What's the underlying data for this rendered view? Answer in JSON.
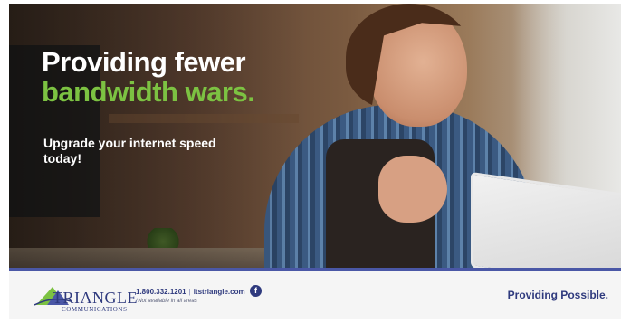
{
  "headline": {
    "line1": "Providing fewer",
    "line2": "bandwidth wars."
  },
  "subhead": "Upgrade your internet speed today!",
  "footer": {
    "logo_text": "TRIANGLE",
    "logo_subtext": "COMMUNICATIONS",
    "phone": "1.800.332.1201",
    "separator": "|",
    "website": "itstriangle.com",
    "disclaimer": "*Not available in all areas",
    "facebook_glyph": "f",
    "tagline": "Providing Possible."
  },
  "colors": {
    "accent_green": "#7cc242",
    "brand_blue": "#2f3a7e",
    "rule_blue": "#4a57a6"
  },
  "icons": {
    "facebook": "facebook-icon",
    "logo_mark": "triangle-logo-icon"
  }
}
